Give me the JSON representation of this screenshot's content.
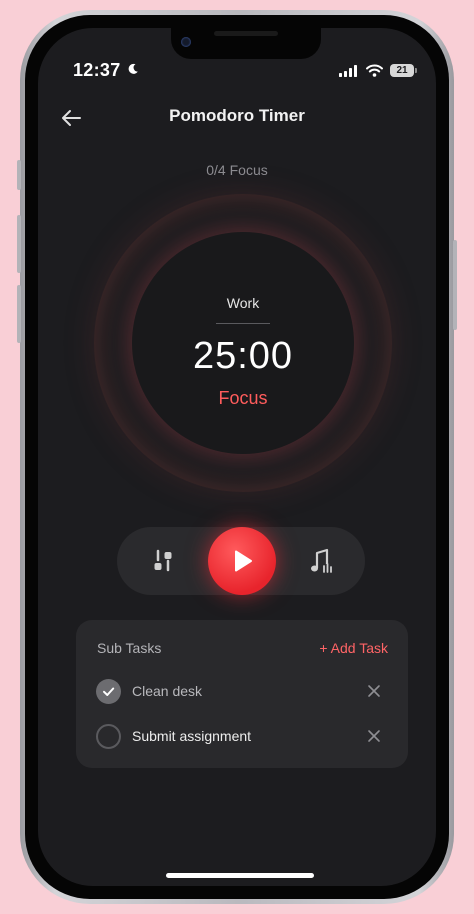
{
  "status_bar": {
    "time": "12:37",
    "battery_level": "21"
  },
  "header": {
    "title": "Pomodoro Timer"
  },
  "session": {
    "counter": "0/4 Focus"
  },
  "timer": {
    "mode": "Work",
    "time": "25:00",
    "phase": "Focus"
  },
  "controls": {
    "left_icon": "settings-sliders-icon",
    "center_icon": "play-icon",
    "right_icon": "music-icon"
  },
  "subtasks": {
    "title": "Sub Tasks",
    "add_label": "+ Add Task",
    "items": [
      {
        "label": "Clean desk",
        "done": true
      },
      {
        "label": "Submit assignment",
        "done": false
      }
    ]
  },
  "colors": {
    "accent": "#ff5c5c",
    "background": "#1c1c1f",
    "card": "#29292c",
    "frame": "#f9cfd6"
  }
}
